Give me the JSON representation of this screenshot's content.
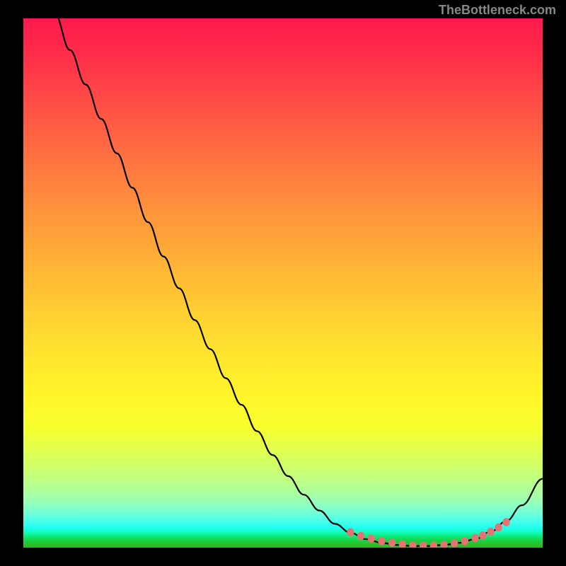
{
  "attribution": "TheBottleneck.com",
  "chart_data": {
    "type": "line",
    "title": "",
    "xlabel": "",
    "ylabel": "",
    "xlim": [
      0,
      100
    ],
    "ylim": [
      0,
      100
    ],
    "background_gradient": {
      "top_color": "#ff1a4d",
      "bottom_color": "#2fb824",
      "description": "red-orange-yellow-green vertical gradient representing bottleneck severity"
    },
    "series": [
      {
        "name": "bottleneck-curve",
        "color": "#000000",
        "x": [
          0,
          3,
          6,
          9,
          12,
          15,
          18,
          21,
          24,
          27,
          30,
          33,
          36,
          39,
          42,
          45,
          48,
          51,
          54,
          57,
          60,
          63,
          66,
          69,
          72,
          75,
          78,
          81,
          84,
          87,
          90,
          93,
          96,
          100
        ],
        "y": [
          115,
          108,
          101,
          94,
          87.5,
          81,
          74.5,
          68,
          61.5,
          55,
          49,
          43,
          37.5,
          32,
          27,
          22,
          17.5,
          13.5,
          10,
          7,
          4.5,
          2.8,
          1.6,
          0.9,
          0.5,
          0.3,
          0.3,
          0.5,
          0.9,
          1.6,
          3,
          5,
          8,
          13
        ]
      },
      {
        "name": "optimal-zone-markers",
        "color": "#e57373",
        "type": "scatter",
        "x": [
          63,
          65,
          67,
          69,
          71,
          73,
          75,
          77,
          79,
          81,
          83,
          85,
          87,
          88.5,
          90,
          91.5,
          93
        ],
        "y": [
          2.9,
          2.2,
          1.7,
          1.2,
          0.9,
          0.6,
          0.4,
          0.35,
          0.35,
          0.5,
          0.8,
          1.2,
          1.8,
          2.3,
          3,
          3.8,
          4.8
        ]
      }
    ]
  }
}
